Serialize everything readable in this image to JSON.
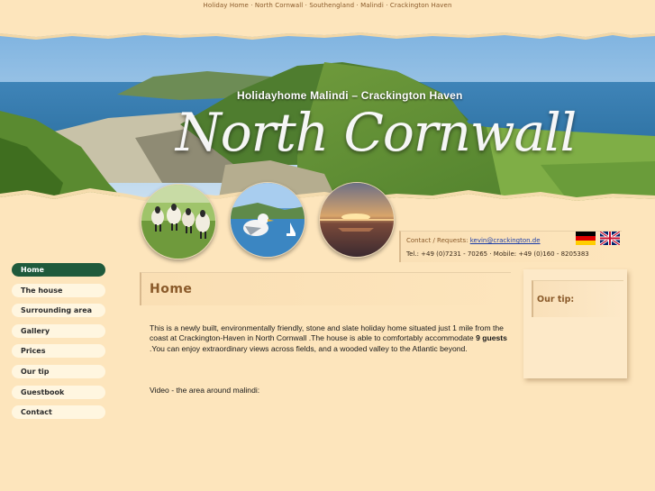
{
  "topbar": {
    "keywords": "Holiday Home · North Cornwall · Southengland · Malindi · Crackington Haven"
  },
  "header": {
    "subtitle": "Holidayhome Malindi – Crackington Haven",
    "title": "North Cornwall"
  },
  "contact": {
    "label": "Contact / Requests:",
    "email": "kevin@crackington.de",
    "phones": "Tel.: +49 (0)7231 - 70265 · Mobile: +49 (0)160 - 8205383"
  },
  "languages": [
    "german-flag-icon",
    "uk-flag-icon"
  ],
  "nav": {
    "items": [
      {
        "label": "Home",
        "active": true
      },
      {
        "label": "The house",
        "active": false
      },
      {
        "label": "Surrounding area",
        "active": false
      },
      {
        "label": "Gallery",
        "active": false
      },
      {
        "label": "Prices",
        "active": false
      },
      {
        "label": "Our tip",
        "active": false
      },
      {
        "label": "Guestbook",
        "active": false
      },
      {
        "label": "Contact",
        "active": false
      }
    ]
  },
  "main": {
    "title": "Home",
    "intro_part1": "This is a newly built, environmentally friendly, stone and slate holiday home situated just 1 mile from the coast at Crackington-Haven in North Cornwall .The house is able to comfortably accommodate ",
    "intro_bold": "9 guests",
    "intro_part2": " .You can enjoy extraordinary views across fields, and a wooded valley to the Atlantic beyond.",
    "video_label": "Video - the area around malindi:"
  },
  "tip": {
    "title": "Our tip:"
  },
  "colors": {
    "background": "#fde5bc",
    "nav_active": "#1f5a3c",
    "heading": "#8a5a2a",
    "link": "#1a3ca8"
  }
}
